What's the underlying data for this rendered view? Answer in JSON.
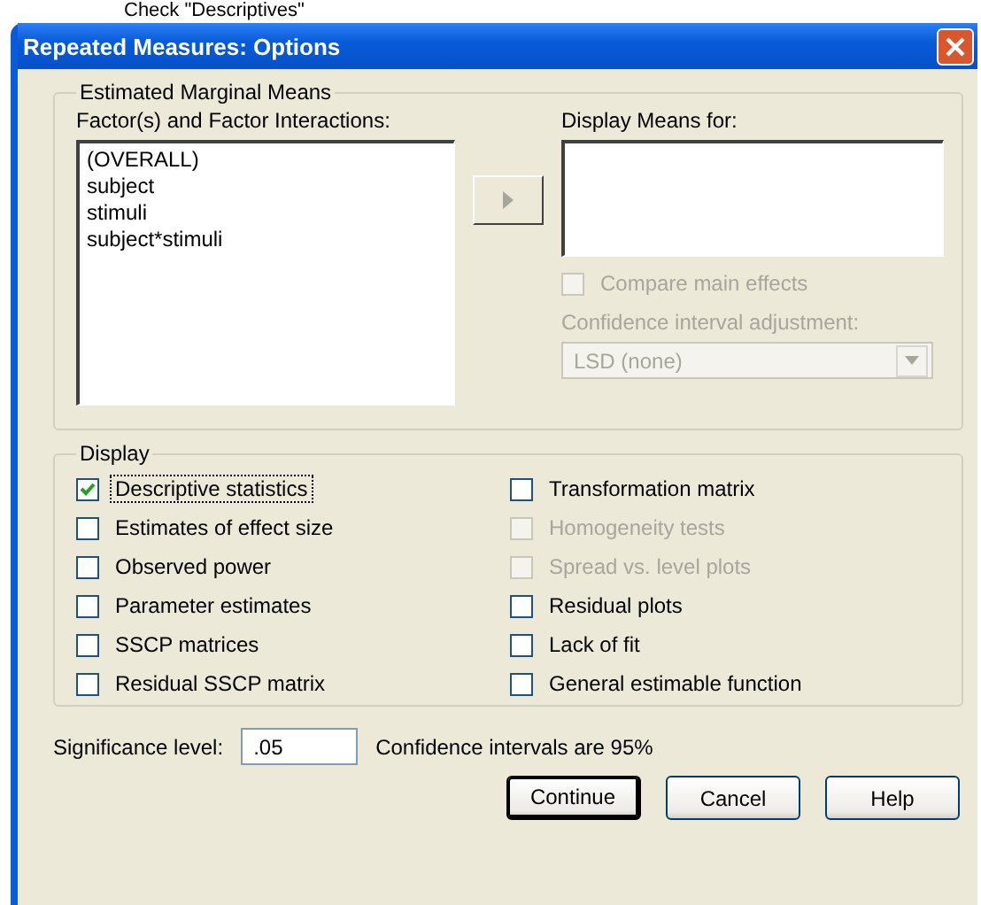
{
  "caption": "Check \"Descriptives\"",
  "window": {
    "title": "Repeated Measures: Options"
  },
  "estimated_marginal_means": {
    "legend": "Estimated Marginal Means",
    "factors_label": "Factor(s) and Factor Interactions:",
    "factors": [
      {
        "label": "(OVERALL)",
        "selected": false
      },
      {
        "label": "subject",
        "selected": false
      },
      {
        "label": "stimuli",
        "selected": false
      },
      {
        "label": "subject*stimuli",
        "selected": false
      }
    ],
    "display_means_label": "Display Means for:",
    "compare_main_effects": {
      "label": "Compare main effects",
      "checked": false,
      "disabled": true
    },
    "adjustment_label": "Confidence interval adjustment:",
    "adjustment": {
      "value": "LSD (none)",
      "disabled": true
    }
  },
  "display": {
    "legend": "Display",
    "options": [
      {
        "label": "Descriptive statistics",
        "checked": true,
        "disabled": false,
        "focused": true
      },
      {
        "label": "Estimates of effect size",
        "checked": false,
        "disabled": false,
        "focused": false
      },
      {
        "label": "Observed power",
        "checked": false,
        "disabled": false,
        "focused": false
      },
      {
        "label": "Parameter estimates",
        "checked": false,
        "disabled": false,
        "focused": false
      },
      {
        "label": "SSCP matrices",
        "checked": false,
        "disabled": false,
        "focused": false
      },
      {
        "label": "Residual SSCP matrix",
        "checked": false,
        "disabled": false,
        "focused": false
      },
      {
        "label": "Transformation matrix",
        "checked": false,
        "disabled": false,
        "focused": false
      },
      {
        "label": "Homogeneity tests",
        "checked": false,
        "disabled": true,
        "focused": false
      },
      {
        "label": "Spread vs. level plots",
        "checked": false,
        "disabled": true,
        "focused": false
      },
      {
        "label": "Residual plots",
        "checked": false,
        "disabled": false,
        "focused": false
      },
      {
        "label": "Lack of fit",
        "checked": false,
        "disabled": false,
        "focused": false
      },
      {
        "label": "General estimable function",
        "checked": false,
        "disabled": false,
        "focused": false
      }
    ]
  },
  "significance": {
    "label": "Significance level:",
    "value": ".05",
    "note": "Confidence intervals are 95%"
  },
  "buttons": [
    {
      "label": "Continue",
      "default": true
    },
    {
      "label": "Cancel",
      "default": false
    },
    {
      "label": "Help",
      "default": false
    }
  ]
}
